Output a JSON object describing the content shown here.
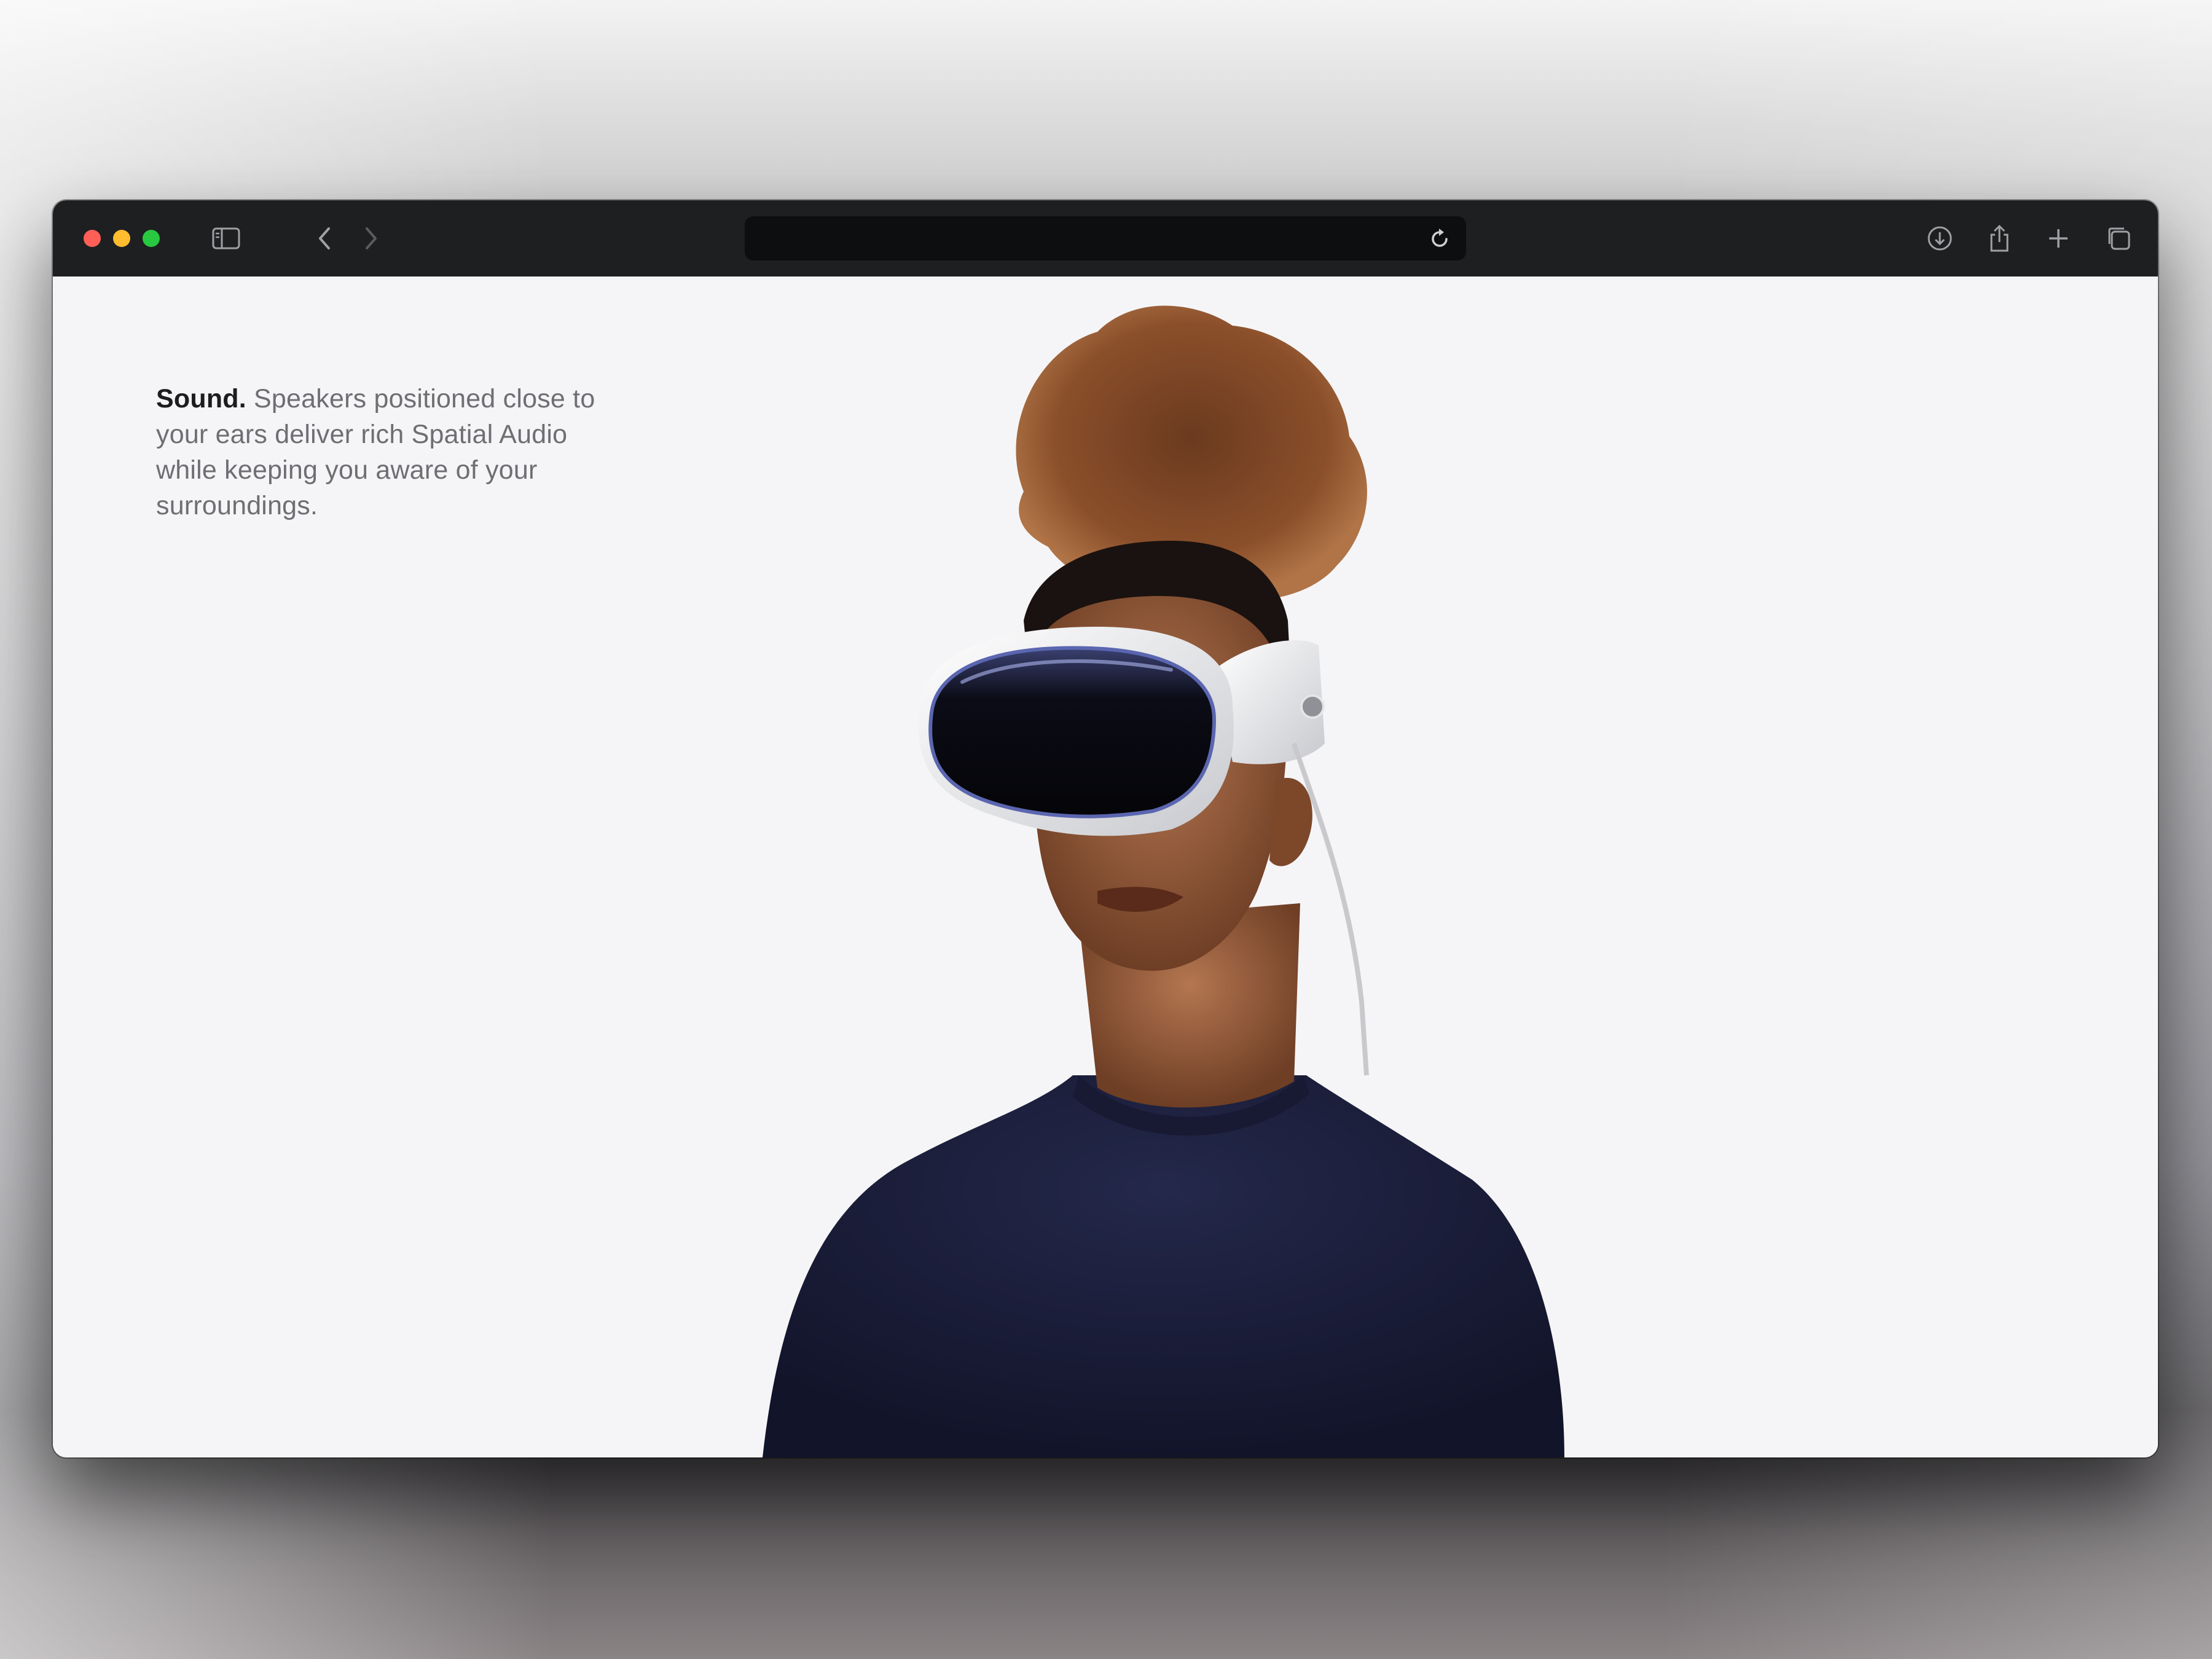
{
  "browser": {
    "window_controls": [
      "close",
      "minimize",
      "zoom"
    ],
    "toolbar_icons": [
      "sidebar-icon",
      "back-icon",
      "forward-icon",
      "shield-icon",
      "reload-icon",
      "download-icon",
      "share-icon",
      "new-tab-icon",
      "tabs-overview-icon"
    ],
    "address_bar": {
      "value": ""
    }
  },
  "page": {
    "feature_title": "Sound.",
    "feature_text": " Speakers positioned close to your ears deliver rich Spatial Audio while keeping you aware of your surroundings.",
    "image": "person-wearing-headset"
  },
  "colors": {
    "toolbar": "#1d1f21",
    "page_background": "#f5f5f7",
    "heading_text": "#1d1d1f",
    "body_text": "#6e6e73",
    "sweater": "#1c1f3a"
  }
}
